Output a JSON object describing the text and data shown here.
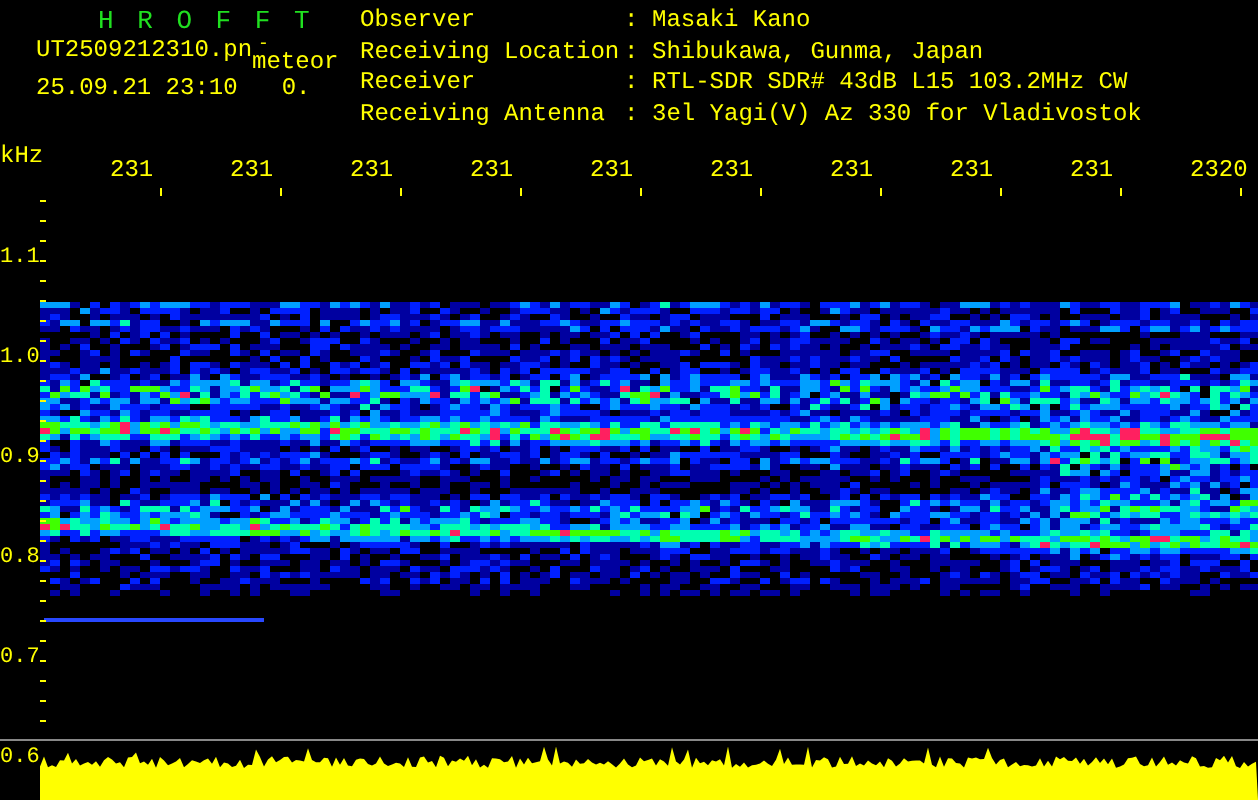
{
  "app_title": "H R O F F T",
  "file": {
    "name": "UT2509212310.pn",
    "kind_label": "meteor",
    "marker": "-",
    "datetime": "25.09.21 23:10",
    "value": "0."
  },
  "info": [
    {
      "label": "Observer",
      "value": "Masaki Kano"
    },
    {
      "label": "Receiving Location",
      "value": "Shibukawa, Gunma, Japan"
    },
    {
      "label": "Receiver",
      "value": "RTL-SDR SDR# 43dB L15 103.2MHz CW"
    },
    {
      "label": "Receiving Antenna",
      "value": "3el Yagi(V) Az 330 for Vladivostok"
    }
  ],
  "separator": ":",
  "freq_unit": "kHz",
  "time_labels": [
    "231",
    "231",
    "231",
    "231",
    "231",
    "231",
    "231",
    "231",
    "231",
    "2320"
  ],
  "freq_labels": [
    "1.1",
    "1.0",
    "0.9",
    "0.8",
    "0.7",
    "0.6"
  ]
}
